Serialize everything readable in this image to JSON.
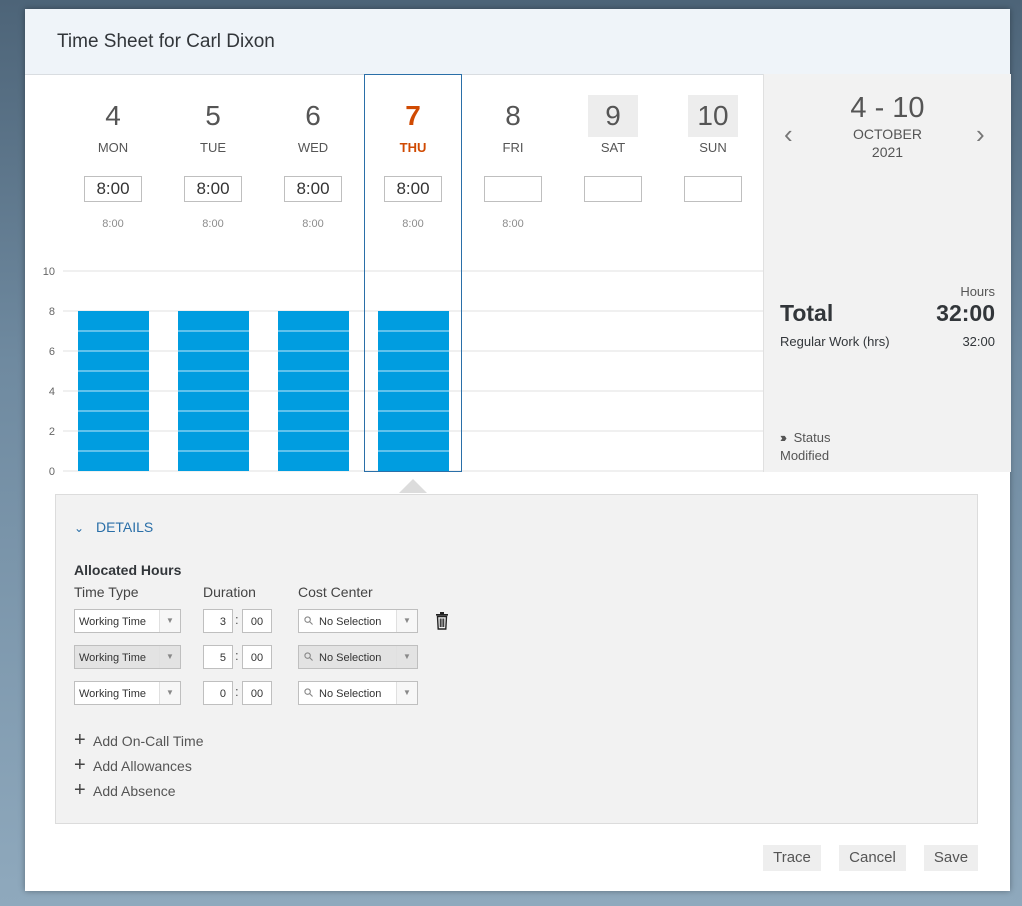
{
  "dialog": {
    "title": "Time Sheet for Carl Dixon"
  },
  "week": {
    "days": [
      {
        "num": "4",
        "name": "MON",
        "input": "8:00",
        "target": "8:00",
        "weekend": false,
        "today": false
      },
      {
        "num": "5",
        "name": "TUE",
        "input": "8:00",
        "target": "8:00",
        "weekend": false,
        "today": false
      },
      {
        "num": "6",
        "name": "WED",
        "input": "8:00",
        "target": "8:00",
        "weekend": false,
        "today": false
      },
      {
        "num": "7",
        "name": "THU",
        "input": "8:00",
        "target": "8:00",
        "weekend": false,
        "today": true
      },
      {
        "num": "8",
        "name": "FRI",
        "input": "",
        "target": "8:00",
        "weekend": false,
        "today": false
      },
      {
        "num": "9",
        "name": "SAT",
        "input": "",
        "target": "",
        "weekend": true,
        "today": false
      },
      {
        "num": "10",
        "name": "SUN",
        "input": "",
        "target": "",
        "weekend": true,
        "today": false
      }
    ]
  },
  "chart_data": {
    "type": "bar",
    "categories": [
      "MON",
      "TUE",
      "WED",
      "THU",
      "FRI",
      "SAT",
      "SUN"
    ],
    "values": [
      8,
      8,
      8,
      8,
      0,
      0,
      0
    ],
    "ylim": [
      0,
      10
    ],
    "y_ticks": [
      "0",
      "2",
      "4",
      "6",
      "8",
      "10"
    ],
    "bar_color": "#009de0",
    "grid": true
  },
  "summary": {
    "range": "4 - 10",
    "month": "OCTOBER",
    "year": "2021",
    "hours_label": "Hours",
    "total_label": "Total",
    "total_value": "32:00",
    "regular_label": "Regular Work (hrs)",
    "regular_value": "32:00",
    "status_label": "Status",
    "status_value": "Modified"
  },
  "details": {
    "toggle_label": "DETAILS",
    "section_title": "Allocated Hours",
    "col_time_type": "Time Type",
    "col_duration": "Duration",
    "col_cost_center": "Cost Center",
    "rows": [
      {
        "time_type": "Working Time",
        "hours": "3",
        "minutes": "00",
        "cost_center": "No Selection"
      },
      {
        "time_type": "Working Time",
        "hours": "5",
        "minutes": "00",
        "cost_center": "No Selection"
      },
      {
        "time_type": "Working Time",
        "hours": "0",
        "minutes": "00",
        "cost_center": "No Selection"
      }
    ],
    "add_on_call": "Add On-Call Time",
    "add_allowances": "Add Allowances",
    "add_absence": "Add Absence"
  },
  "footer": {
    "trace": "Trace",
    "cancel": "Cancel",
    "save": "Save"
  },
  "colors": {
    "accent": "#2a6fa8",
    "today": "#d04a02",
    "bar": "#009de0"
  }
}
